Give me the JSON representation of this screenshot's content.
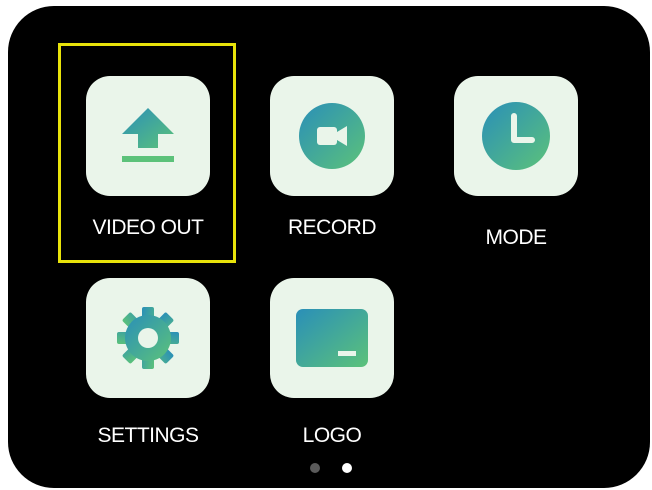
{
  "menu": {
    "items": [
      {
        "label": "VIDEO OUT",
        "icon": "upload-icon",
        "selected": true
      },
      {
        "label": "RECORD",
        "icon": "video-camera-icon",
        "selected": false
      },
      {
        "label": "MODE",
        "icon": "clock-icon",
        "selected": false
      },
      {
        "label": "SETTINGS",
        "icon": "gear-icon",
        "selected": false
      },
      {
        "label": "LOGO",
        "icon": "logo-image-icon",
        "selected": false
      }
    ]
  },
  "pagination": {
    "page_count": 2,
    "current_page": 2
  },
  "colors": {
    "screen_background": "#000000",
    "tile_background": "#eaf5ea",
    "selection_border": "#e8e30a",
    "icon_gradient_start": "#2a8fb8",
    "icon_gradient_end": "#5cc27a",
    "dot_active": "#ffffff",
    "dot_inactive": "#5b5b5b"
  }
}
